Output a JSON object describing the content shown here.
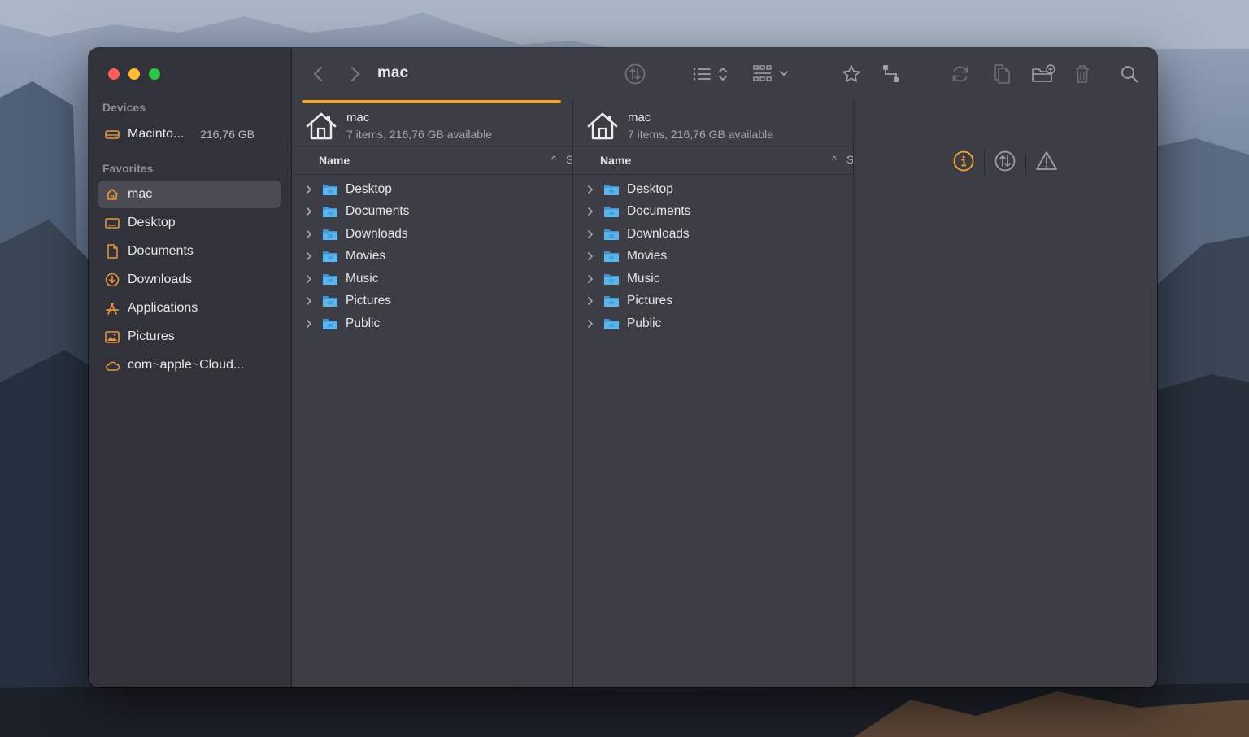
{
  "window": {
    "title": "mac"
  },
  "sidebar": {
    "devices_heading": "Devices",
    "devices": [
      {
        "label": "Macinto...",
        "size": "216,76 GB",
        "icon": "drive-icon"
      }
    ],
    "favorites_heading": "Favorites",
    "favorites": [
      {
        "label": "mac",
        "icon": "home-icon",
        "selected": true
      },
      {
        "label": "Desktop",
        "icon": "desktop-icon"
      },
      {
        "label": "Documents",
        "icon": "document-icon"
      },
      {
        "label": "Downloads",
        "icon": "download-icon"
      },
      {
        "label": "Applications",
        "icon": "applications-icon"
      },
      {
        "label": "Pictures",
        "icon": "pictures-icon"
      },
      {
        "label": "com~apple~Cloud...",
        "icon": "cloud-icon"
      }
    ]
  },
  "panes": [
    {
      "name": "mac",
      "info": "7 items, 216,76 GB available",
      "column_name": "Name",
      "column_size": "S",
      "items": [
        "Desktop",
        "Documents",
        "Downloads",
        "Movies",
        "Music",
        "Pictures",
        "Public"
      ]
    },
    {
      "name": "mac",
      "info": "7 items, 216,76 GB available",
      "column_name": "Name",
      "column_size": "S",
      "items": [
        "Desktop",
        "Documents",
        "Downloads",
        "Movies",
        "Music",
        "Pictures",
        "Public"
      ]
    }
  ],
  "colors": {
    "accent": "#f5a623",
    "folder": "#5ab6ef",
    "sidebar_icon": "#e8963a"
  }
}
